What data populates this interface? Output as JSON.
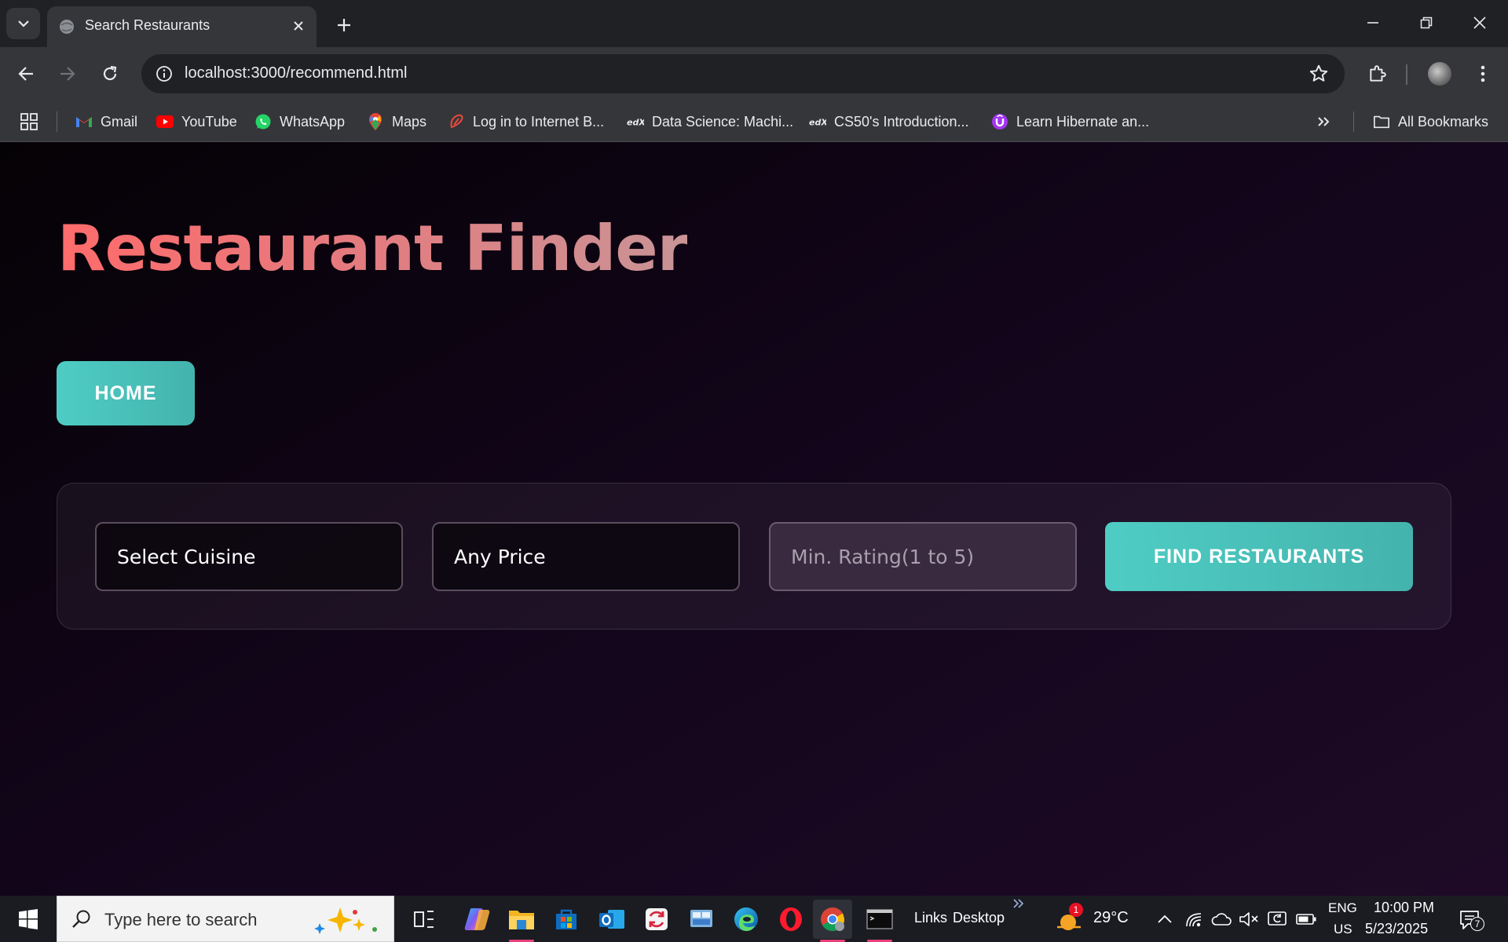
{
  "browser": {
    "tab_title": "Search Restaurants",
    "url": "localhost:3000/recommend.html",
    "bookmarks": [
      {
        "label": "Gmail",
        "icon": "gmail-icon"
      },
      {
        "label": "YouTube",
        "icon": "youtube-icon"
      },
      {
        "label": "WhatsApp",
        "icon": "whatsapp-icon"
      },
      {
        "label": "Maps",
        "icon": "maps-icon"
      },
      {
        "label": "Log in to Internet B...",
        "icon": "bank-icon"
      },
      {
        "label": "Data Science: Machi...",
        "icon": "edx-icon"
      },
      {
        "label": "CS50's Introduction...",
        "icon": "edx-icon"
      },
      {
        "label": "Learn Hibernate an...",
        "icon": "udemy-icon"
      }
    ],
    "all_bookmarks_label": "All Bookmarks"
  },
  "page": {
    "title": "Restaurant Finder",
    "home_label": "HOME",
    "cuisine_value": "Select Cuisine",
    "price_value": "Any Price",
    "rating_placeholder": "Min. Rating(1 to 5)",
    "find_label": "FIND RESTAURANTS"
  },
  "taskbar": {
    "search_placeholder": "Type here to search",
    "links_label": "Links",
    "desktop_label": "Desktop",
    "weather_badge": "1",
    "temperature": "29°C",
    "lang_top": "ENG",
    "lang_bottom": "US",
    "time": "10:00 PM",
    "date": "5/23/2025",
    "notification_count": "7"
  },
  "colors": {
    "accent": "#4ecdc4",
    "title_start": "#ff6b6b",
    "page_bg": "#12051a"
  }
}
